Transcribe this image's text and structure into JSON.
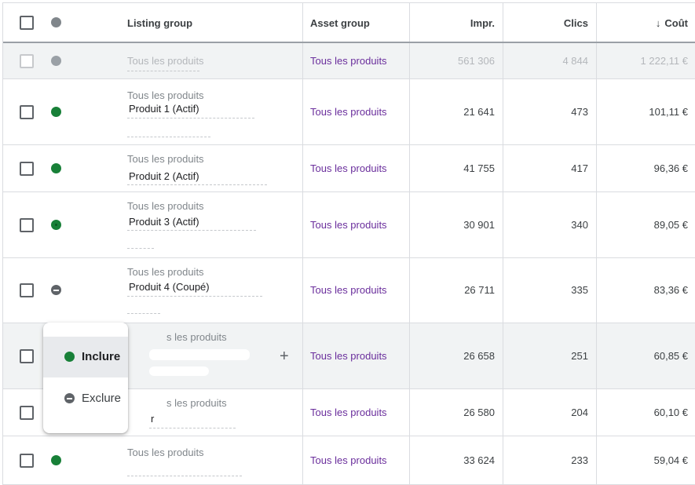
{
  "header": {
    "listing_group": "Listing group",
    "asset_group": "Asset group",
    "impr": "Impr.",
    "clics": "Clics",
    "cout": "Coût",
    "sort_icon": "arrow-down-icon"
  },
  "rows": [
    {
      "listing_top": "Tous les produits",
      "listing_name": "",
      "asset": "Tous les produits",
      "impr": "561 306",
      "clics": "4 844",
      "cout": "1 222,11 €",
      "status": "grey"
    },
    {
      "listing_top": "Tous les produits",
      "listing_name": "Produit 1 (Actif)",
      "asset": "Tous les produits",
      "impr": "21 641",
      "clics": "473",
      "cout": "101,11 €",
      "status": "green"
    },
    {
      "listing_top": "Tous les produits",
      "listing_name": "Produit 2 (Actif)",
      "asset": "Tous les produits",
      "impr": "41 755",
      "clics": "417",
      "cout": "96,36 €",
      "status": "green"
    },
    {
      "listing_top": "Tous les produits",
      "listing_name": "Produit 3 (Actif)",
      "asset": "Tous les produits",
      "impr": "30 901",
      "clics": "340",
      "cout": "89,05 €",
      "status": "green"
    },
    {
      "listing_top": "Tous les produits",
      "listing_name": "Produit 4 (Coupé)",
      "asset": "Tous les produits",
      "impr": "26 711",
      "clics": "335",
      "cout": "83,36 €",
      "status": "exclude"
    },
    {
      "listing_top": "s les produits",
      "listing_name": "",
      "asset": "Tous les produits",
      "impr": "26 658",
      "clics": "251",
      "cout": "60,85 €",
      "status": "none"
    },
    {
      "listing_top": "s les produits",
      "listing_name": "r",
      "asset": "Tous les produits",
      "impr": "26 580",
      "clics": "204",
      "cout": "60,10 €",
      "status": "none"
    },
    {
      "listing_top": "Tous les produits",
      "listing_name": "",
      "asset": "Tous les produits",
      "impr": "33 624",
      "clics": "233",
      "cout": "59,04 €",
      "status": "green"
    }
  ],
  "popup": {
    "include_label": "Inclure",
    "exclude_label": "Exclure"
  },
  "colors": {
    "active": "#188038",
    "link": "#6a2e9c",
    "excluded": "#5f6368"
  }
}
